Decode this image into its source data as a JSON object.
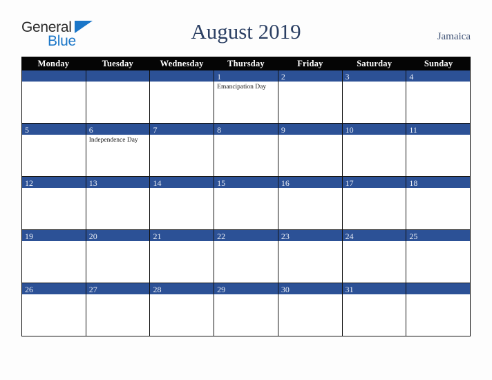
{
  "brand": {
    "word_one": "General",
    "word_two": "Blue",
    "triangle_icon": "blue-triangle-logo-mark",
    "colors": {
      "general_text": "#2b2b2b",
      "blue_text": "#1a76c8",
      "triangle": "#1a76c8"
    }
  },
  "header": {
    "title": "August 2019",
    "locale": "Jamaica",
    "title_color": "#2b3f63",
    "locale_color": "#3b4f73"
  },
  "calendar": {
    "month": "August",
    "year": "2019",
    "country": "Jamaica",
    "header_background": "#050505",
    "day_band_color": "#2c5196",
    "weekdays": [
      "Monday",
      "Tuesday",
      "Wednesday",
      "Thursday",
      "Friday",
      "Saturday",
      "Sunday"
    ],
    "weeks": [
      [
        {
          "day": "",
          "event": ""
        },
        {
          "day": "",
          "event": ""
        },
        {
          "day": "",
          "event": ""
        },
        {
          "day": "1",
          "event": "Emancipation Day"
        },
        {
          "day": "2",
          "event": ""
        },
        {
          "day": "3",
          "event": ""
        },
        {
          "day": "4",
          "event": ""
        }
      ],
      [
        {
          "day": "5",
          "event": ""
        },
        {
          "day": "6",
          "event": "Independence Day"
        },
        {
          "day": "7",
          "event": ""
        },
        {
          "day": "8",
          "event": ""
        },
        {
          "day": "9",
          "event": ""
        },
        {
          "day": "10",
          "event": ""
        },
        {
          "day": "11",
          "event": ""
        }
      ],
      [
        {
          "day": "12",
          "event": ""
        },
        {
          "day": "13",
          "event": ""
        },
        {
          "day": "14",
          "event": ""
        },
        {
          "day": "15",
          "event": ""
        },
        {
          "day": "16",
          "event": ""
        },
        {
          "day": "17",
          "event": ""
        },
        {
          "day": "18",
          "event": ""
        }
      ],
      [
        {
          "day": "19",
          "event": ""
        },
        {
          "day": "20",
          "event": ""
        },
        {
          "day": "21",
          "event": ""
        },
        {
          "day": "22",
          "event": ""
        },
        {
          "day": "23",
          "event": ""
        },
        {
          "day": "24",
          "event": ""
        },
        {
          "day": "25",
          "event": ""
        }
      ],
      [
        {
          "day": "26",
          "event": ""
        },
        {
          "day": "27",
          "event": ""
        },
        {
          "day": "28",
          "event": ""
        },
        {
          "day": "29",
          "event": ""
        },
        {
          "day": "30",
          "event": ""
        },
        {
          "day": "31",
          "event": ""
        },
        {
          "day": "",
          "event": ""
        }
      ]
    ]
  }
}
